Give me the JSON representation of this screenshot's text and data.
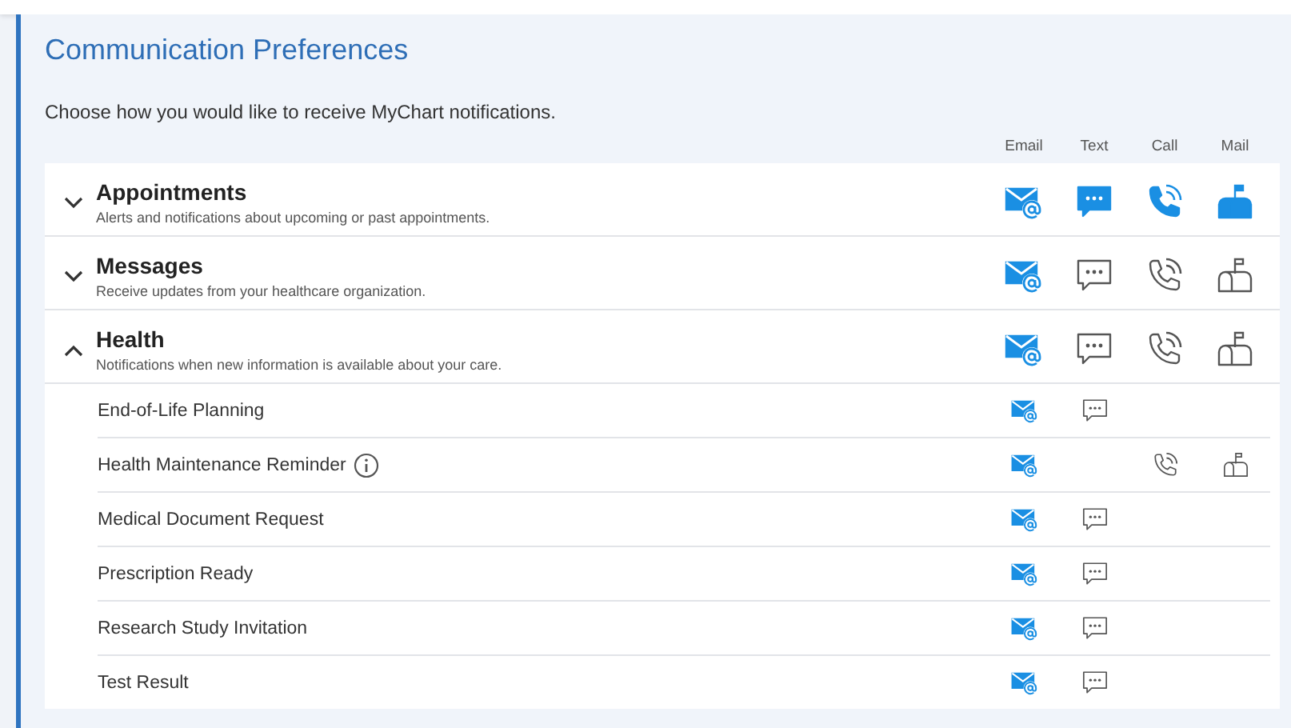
{
  "title": "Communication Preferences",
  "intro": "Choose how you would like to receive MyChart notifications.",
  "columns": [
    "Email",
    "Text",
    "Call",
    "Mail"
  ],
  "categories": [
    {
      "name": "Appointments",
      "description": "Alerts and notifications about upcoming or past appointments.",
      "expanded": false,
      "email": true,
      "text": true,
      "call": true,
      "mail": true
    },
    {
      "name": "Messages",
      "description": "Receive updates from your healthcare organization.",
      "expanded": false,
      "email": true,
      "text": false,
      "call": false,
      "mail": false
    },
    {
      "name": "Health",
      "description": "Notifications when new information is available about your care.",
      "expanded": true,
      "email": true,
      "text": false,
      "call": false,
      "mail": false,
      "items": [
        {
          "name": "End-of-Life Planning",
          "info": false,
          "email": true,
          "text": false
        },
        {
          "name": "Health Maintenance Reminder",
          "info": true,
          "email": true,
          "call": false,
          "mail": false
        },
        {
          "name": "Medical Document Request",
          "info": false,
          "email": true,
          "text": false
        },
        {
          "name": "Prescription Ready",
          "info": false,
          "email": true,
          "text": false
        },
        {
          "name": "Research Study Invitation",
          "info": false,
          "email": true,
          "text": false
        },
        {
          "name": "Test Result",
          "info": false,
          "email": true,
          "text": false
        }
      ]
    }
  ]
}
